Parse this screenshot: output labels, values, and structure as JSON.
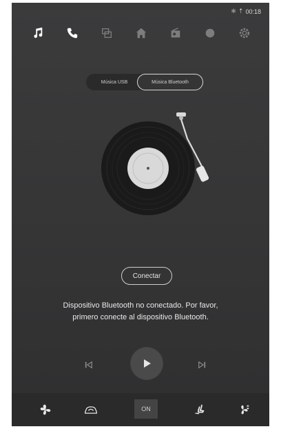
{
  "status": {
    "time": "00:18",
    "icons": [
      "bluetooth-icon",
      "signal-icon"
    ]
  },
  "nav": {
    "items": [
      {
        "name": "music",
        "icon": "music-note-icon",
        "active": true
      },
      {
        "name": "phone",
        "icon": "phone-icon",
        "active": true
      },
      {
        "name": "media",
        "icon": "media-icon",
        "active": false
      },
      {
        "name": "home",
        "icon": "home-icon",
        "active": false
      },
      {
        "name": "radio",
        "icon": "radio-icon",
        "active": false
      },
      {
        "name": "apps",
        "icon": "apps-icon",
        "active": false
      },
      {
        "name": "settings",
        "icon": "gear-icon",
        "active": false
      }
    ]
  },
  "source": {
    "usb_label": "Música USB",
    "bt_label": "Música Bluetooth",
    "selected": "bluetooth"
  },
  "connect": {
    "label": "Conectar"
  },
  "message": {
    "line1": "Dispositivo Bluetooth no conectado. Por favor,",
    "line2": "primero conecte al dispositivo Bluetooth."
  },
  "player": {
    "prev_icon": "skip-previous-icon",
    "play_icon": "play-icon",
    "next_icon": "skip-next-icon"
  },
  "bottom": {
    "items": [
      "fan-icon",
      "car-recirculation-icon",
      "ac-toggle",
      "seat-heat-icon",
      "fan-speed-icon"
    ],
    "on_label": "ON"
  },
  "colors": {
    "background": "#353536",
    "text": "#e9e9e9",
    "accent": "#ffffff"
  }
}
